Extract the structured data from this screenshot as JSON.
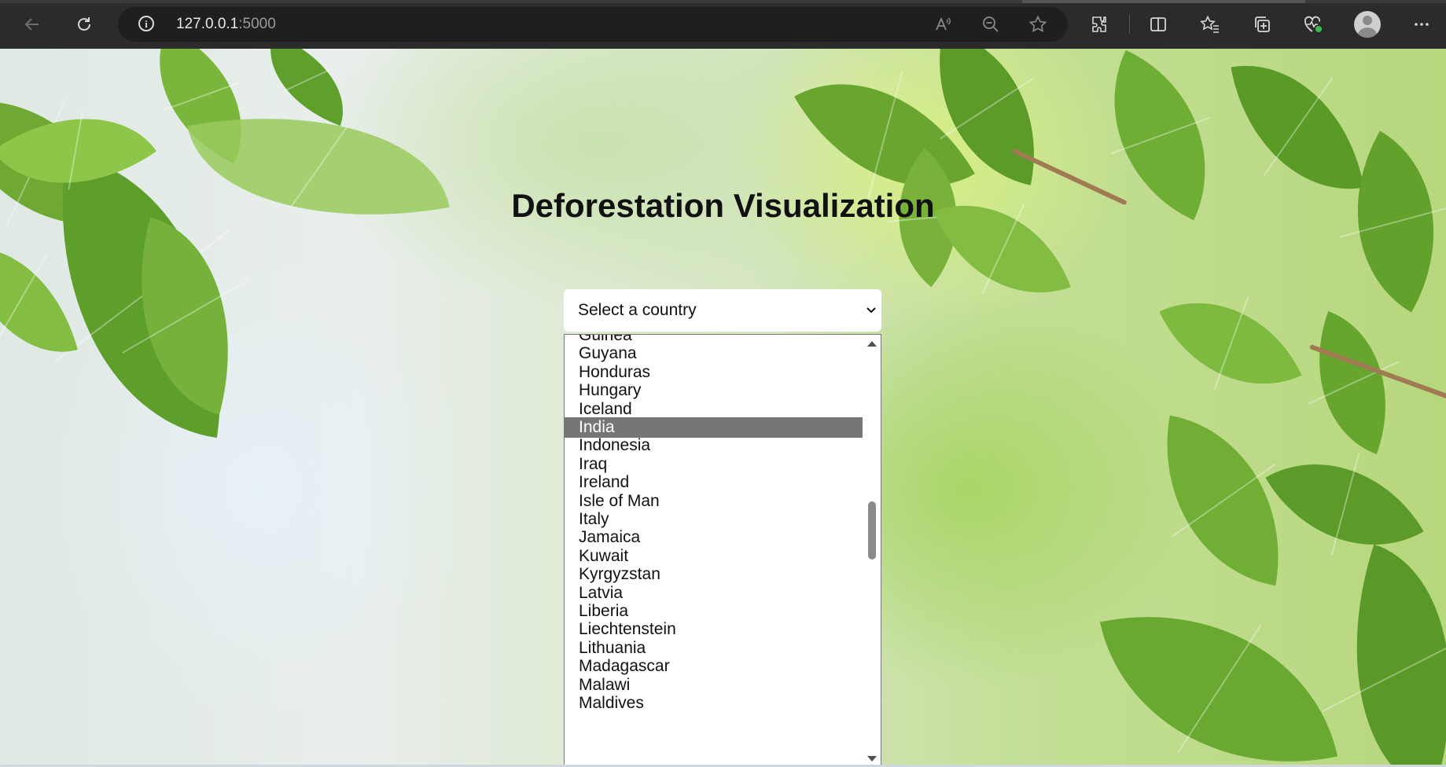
{
  "browser": {
    "url_host": "127.0.0.1",
    "url_port": ":5000",
    "icons": {
      "back": "back-arrow-icon",
      "reload": "reload-icon",
      "info": "site-info-icon",
      "read_aloud": "read-aloud-icon",
      "zoom": "zoom-out-icon",
      "favorite": "favorite-star-icon",
      "extensions": "extensions-icon",
      "split": "split-screen-icon",
      "favorites": "favorites-icon",
      "collections": "collections-icon",
      "health": "browser-essentials-icon",
      "profile": "profile-avatar-icon",
      "menu": "more-menu-icon"
    }
  },
  "page": {
    "title": "Deforestation Visualization",
    "select": {
      "label": "Select a country",
      "options": [
        "Guinea",
        "Guyana",
        "Honduras",
        "Hungary",
        "Iceland",
        "India",
        "Indonesia",
        "Iraq",
        "Ireland",
        "Isle of Man",
        "Italy",
        "Jamaica",
        "Kuwait",
        "Kyrgyzstan",
        "Latvia",
        "Liberia",
        "Liechtenstein",
        "Lithuania",
        "Madagascar",
        "Malawi",
        "Maldives"
      ],
      "highlighted": "India"
    }
  },
  "colors": {
    "chrome": "#2b2b2b",
    "highlight": "#767676",
    "title": "#111111"
  }
}
